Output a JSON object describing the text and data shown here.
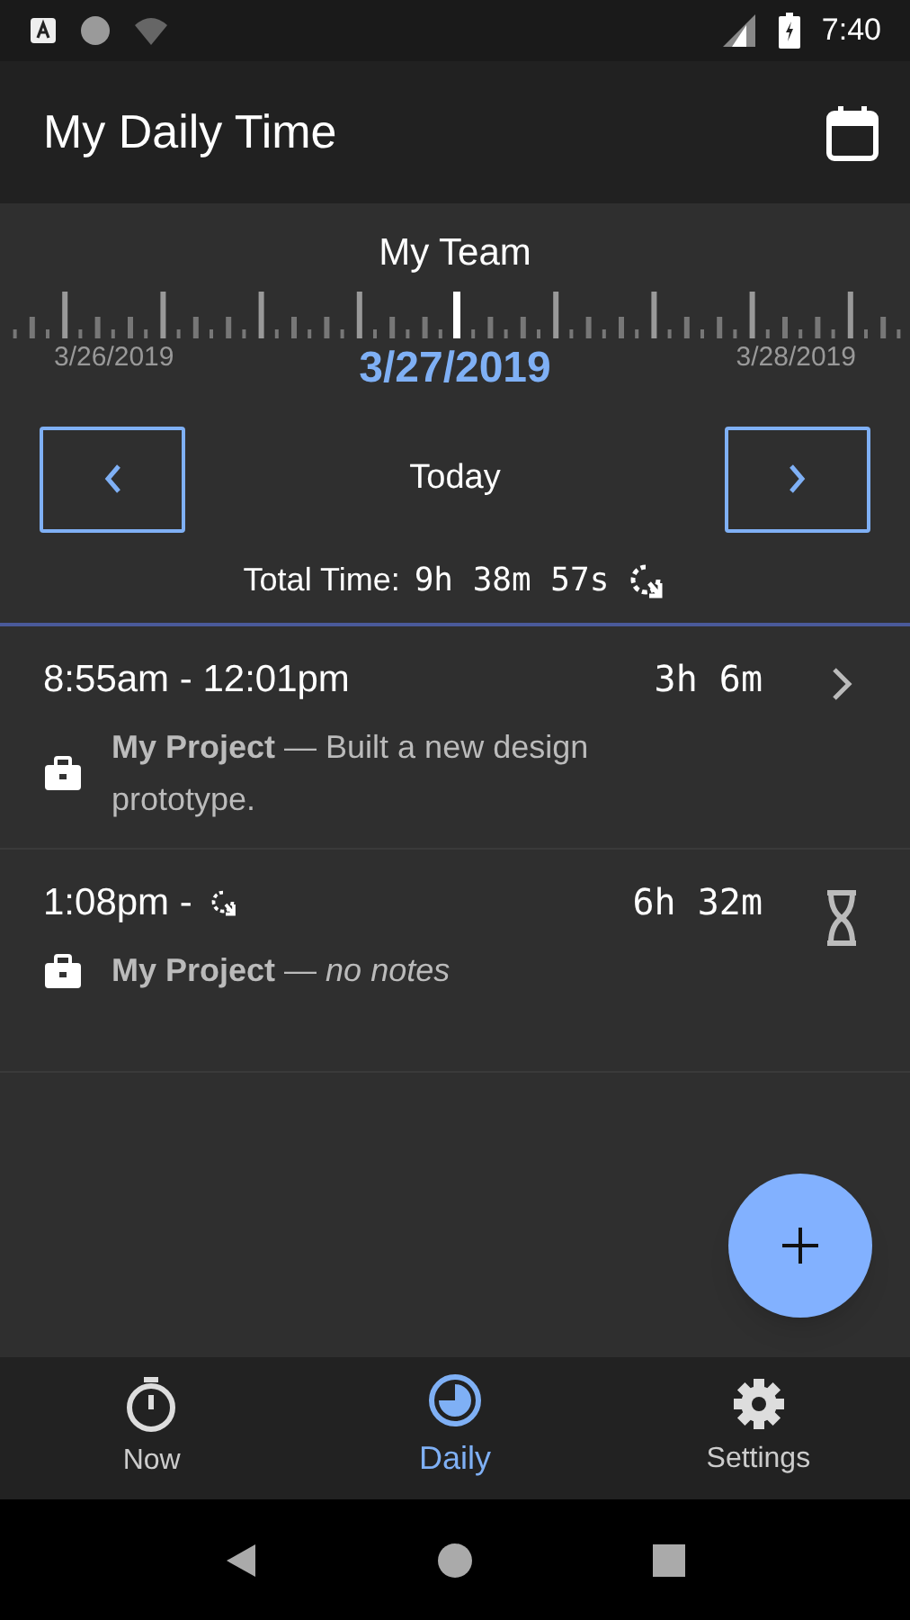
{
  "status_bar": {
    "time": "7:40"
  },
  "app_bar": {
    "title": "My Daily Time"
  },
  "date_picker": {
    "team": "My Team",
    "prev_date": "3/26/2019",
    "current_date": "3/27/2019",
    "next_date": "3/28/2019",
    "day_label": "Today"
  },
  "total": {
    "label": "Total Time:",
    "value": "9h 38m 57s"
  },
  "entries": [
    {
      "kind": "finished",
      "time": "8:55am - 12:01pm",
      "duration": "3h 6m",
      "description": "**My Project** — Built a new design prototype."
    },
    {
      "kind": "running",
      "time": "1:08pm -",
      "duration": "6h 32m",
      "description": "**My Project** — *no notes*"
    }
  ],
  "bottom_nav": [
    {
      "label": "Now",
      "kind": "stopwatch",
      "selected": false
    },
    {
      "label": "Daily",
      "kind": "clock",
      "selected": true
    },
    {
      "label": "Settings",
      "kind": "gear",
      "selected": false
    }
  ]
}
